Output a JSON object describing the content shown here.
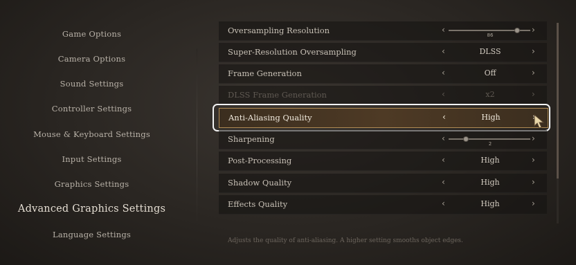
{
  "sidebar": {
    "items": [
      {
        "label": "Game Options"
      },
      {
        "label": "Camera Options"
      },
      {
        "label": "Sound Settings"
      },
      {
        "label": "Controller Settings"
      },
      {
        "label": "Mouse & Keyboard Settings"
      },
      {
        "label": "Input Settings"
      },
      {
        "label": "Graphics Settings"
      },
      {
        "label": "Advanced Graphics Settings",
        "active": true
      },
      {
        "label": "Language Settings"
      }
    ]
  },
  "settings": [
    {
      "label": "Oversampling Resolution",
      "type": "slider",
      "value": "86",
      "slider_fraction": 0.83
    },
    {
      "label": "Super-Resolution Oversampling",
      "type": "select",
      "value": "DLSS"
    },
    {
      "label": "Frame Generation",
      "type": "select",
      "value": "Off"
    },
    {
      "label": "DLSS Frame Generation",
      "type": "select",
      "value": "x2",
      "disabled": true
    },
    {
      "label": "Anti-Aliasing Quality",
      "type": "select",
      "value": "High",
      "selected": true
    },
    {
      "label": "Sharpening",
      "type": "slider",
      "value": "2",
      "slider_fraction": 0.2
    },
    {
      "label": "Post-Processing",
      "type": "select",
      "value": "High"
    },
    {
      "label": "Shadow Quality",
      "type": "select",
      "value": "High"
    },
    {
      "label": "Effects Quality",
      "type": "select",
      "value": "High"
    }
  ],
  "arrows": {
    "left": "‹",
    "right": "›"
  },
  "description": "Adjusts the quality of anti-aliasing. A higher setting smooths object edges.",
  "colors": {
    "highlight_border": "#b08b54",
    "selection_outline": "#f2f2f2"
  }
}
